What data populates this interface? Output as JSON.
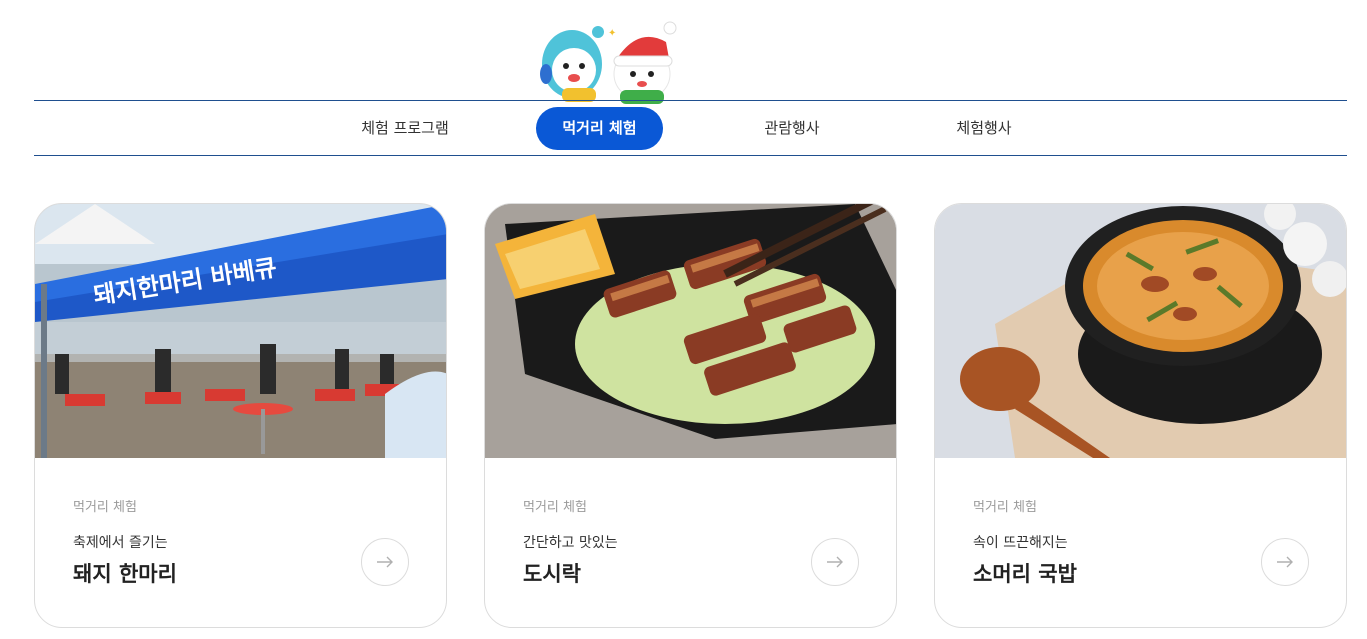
{
  "nav": {
    "tabs": [
      {
        "label": "체험 프로그램",
        "active": false
      },
      {
        "label": "먹거리 체험",
        "active": true
      },
      {
        "label": "관람행사",
        "active": false
      },
      {
        "label": "체험행사",
        "active": false
      }
    ]
  },
  "banner_text": "돼지한마리 바베큐",
  "cards": [
    {
      "category": "먹거리 체험",
      "subtitle": "축제에서 즐기는",
      "title": "돼지 한마리",
      "image": "bbq-tent-photo",
      "arrow_icon": "arrow-right-icon"
    },
    {
      "category": "먹거리 체험",
      "subtitle": "간단하고 맛있는",
      "title": "도시락",
      "image": "lunchbox-photo",
      "arrow_icon": "arrow-right-icon"
    },
    {
      "category": "먹거리 체험",
      "subtitle": "속이 뜨끈해지는",
      "title": "소머리 국밥",
      "image": "gukbap-photo",
      "arrow_icon": "arrow-right-icon"
    }
  ],
  "colors": {
    "accent": "#0a58d6",
    "line": "#1f4f8f",
    "muted": "#9a9a9a"
  }
}
